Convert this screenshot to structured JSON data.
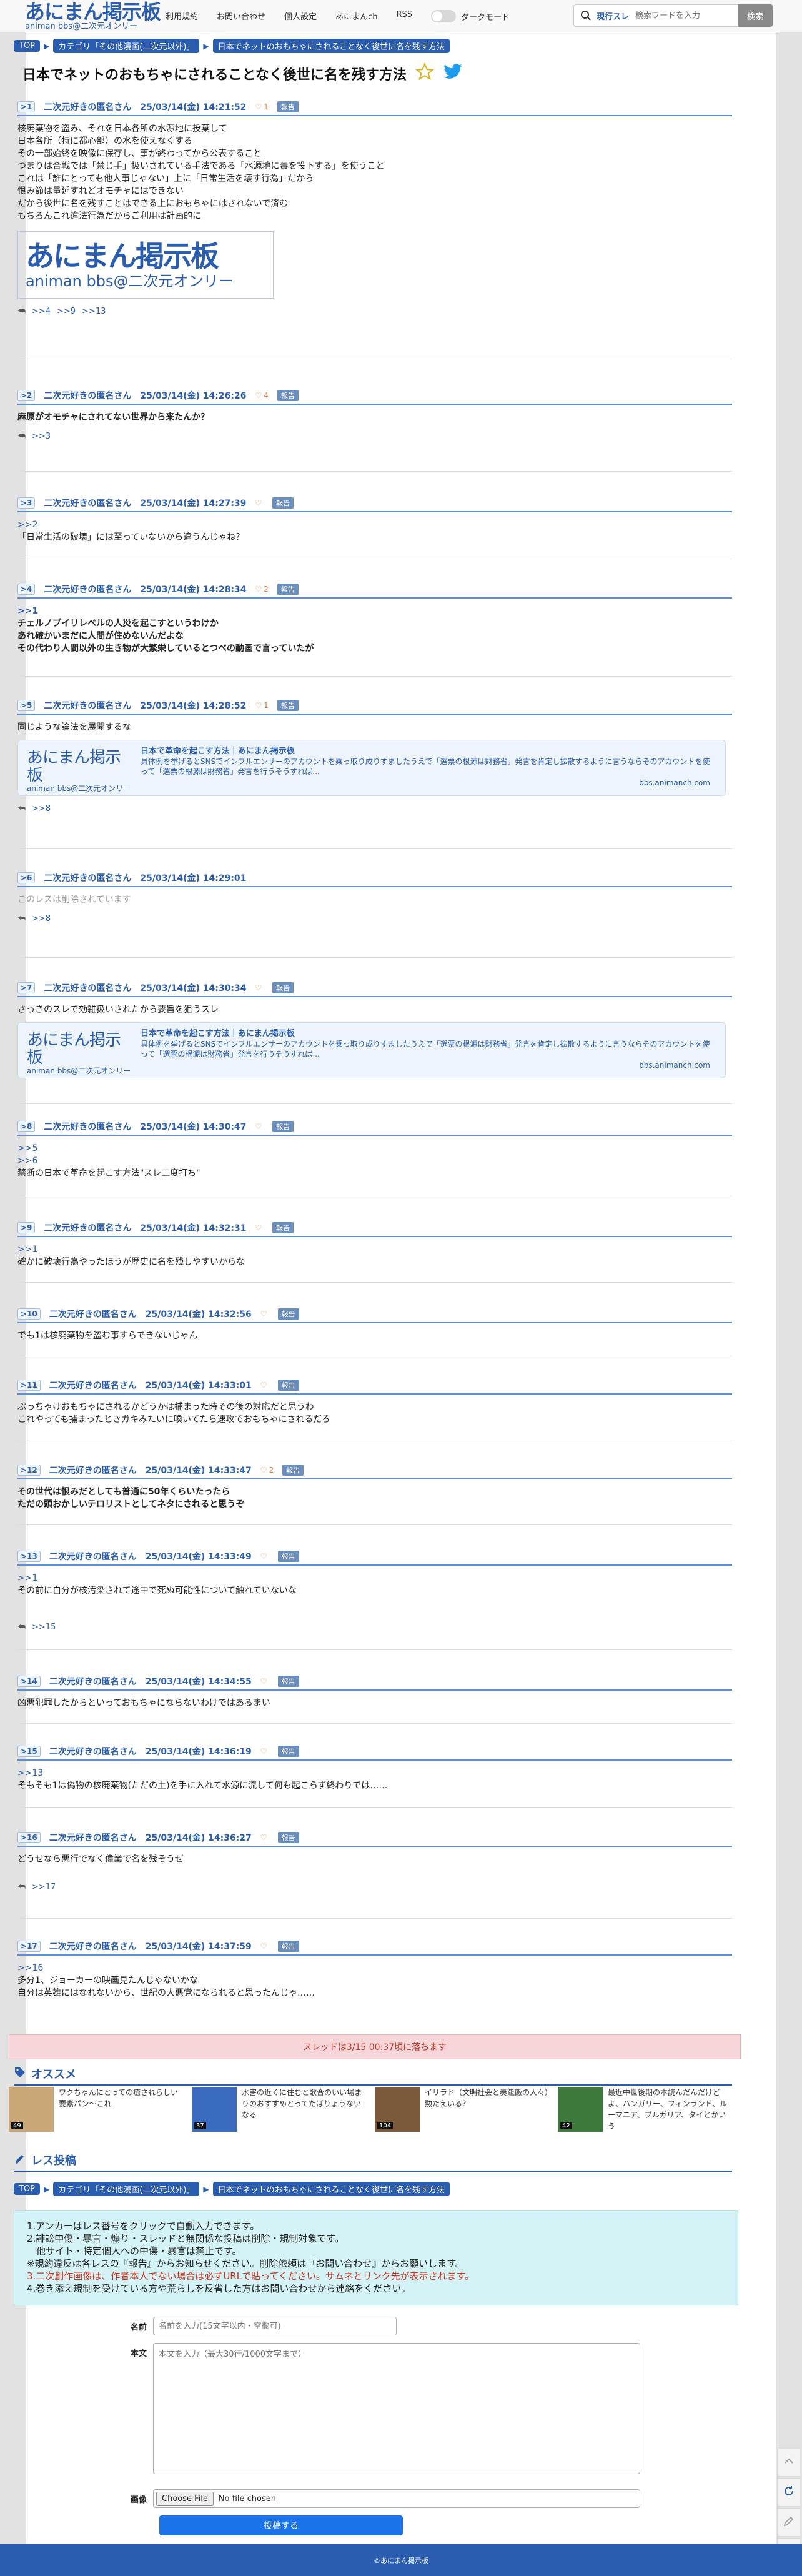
{
  "header": {
    "logo_main": "あにまん掲示板",
    "logo_sub": "animan bbs@二次元オンリー",
    "nav": [
      "利用規約",
      "お問い合わせ",
      "個人設定",
      "あにまんch",
      "RSS"
    ],
    "dark_mode_label": "ダークモード",
    "search_scope": "現行スレ",
    "search_placeholder": "検索ワードを入力",
    "search_button": "検索"
  },
  "breadcrumb": {
    "top": "TOP",
    "category": "カテゴリ「その他漫画(二次元以外)」",
    "thread": "日本でネットのおもちゃにされることなく後世に名を残す方法"
  },
  "thread_title": "日本でネットのおもちゃにされることなく後世に名を残す方法",
  "report_label": "報告",
  "posts": [
    {
      "num": ">1",
      "name": "二次元好きの匿名さん",
      "date": "25/03/14(金) 14:21:52",
      "likes": "1",
      "lines": [
        "核廃棄物を盗み、それを日本各所の水源地に投棄して",
        "日本各所（特に都心部）の水を使えなくする",
        "その一部始終を映像に保存し、事が終わってから公表すること",
        "つまりは合戦では「禁じ手」扱いされている手法である「水源地に毒を投下する」を使うこと",
        "これは「誰にとっても他人事じゃない」上に「日常生活を壊す行為」だから",
        "恨み節は量延すれどオモチャにはできない",
        "だから後世に名を残すことはできる上におもちゃにはされないで済む",
        "もちろんこれ違法行為だからご利用は計画的に"
      ],
      "image_main": "あにまん掲示板",
      "image_sub": "animan bbs@二次元オンリー",
      "replies": [
        ">>4",
        ">>9",
        ">>13"
      ]
    },
    {
      "num": ">2",
      "name": "二次元好きの匿名さん",
      "date": "25/03/14(金) 14:26:26",
      "likes": "4",
      "lines": [
        "麻原がオモチャにされてない世界から来たんか？"
      ],
      "replies": [
        ">>3"
      ]
    },
    {
      "num": ">3",
      "name": "二次元好きの匿名さん",
      "date": "25/03/14(金) 14:27:39",
      "likes": "",
      "anchor": ">>2",
      "lines": [
        "「日常生活の破壊」には至っていないから違うんじゃね？"
      ]
    },
    {
      "num": ">4",
      "name": "二次元好きの匿名さん",
      "date": "25/03/14(金) 14:28:34",
      "likes": "2",
      "anchor": ">>1",
      "lines": [
        "チェルノブイリレベルの人災を起こすというわけか",
        "あれ確かいまだに人間が住めないんだよな",
        "その代わり人間以外の生き物が大繁栄しているとつべの動画で言っていたが"
      ]
    },
    {
      "num": ">5",
      "name": "二次元好きの匿名さん",
      "date": "25/03/14(金) 14:28:52",
      "likes": "1",
      "lines": [
        "同じような論法を展開するな"
      ],
      "link_card": {
        "logo_main": "あにまん掲示板",
        "logo_sub": "animan bbs@二次元オンリー",
        "title": "日本で革命を起こす方法｜あにまん掲示板",
        "desc": "具体例を挙げるとSNSでインフルエンサーのアカウントを乗っ取り成りすましたうえで「選票の根源は財務省」発言を肯定し拡散するように言うならそのアカウントを使って「選票の根源は財務省」発言を行うそうすれば...",
        "domain": "bbs.animanch.com"
      },
      "replies": [
        ">>8"
      ]
    },
    {
      "num": ">6",
      "name": "二次元好きの匿名さん",
      "date": "25/03/14(金) 14:29:01",
      "likes": "",
      "deleted": "このレスは削除されています",
      "replies": [
        ">>8"
      ]
    },
    {
      "num": ">7",
      "name": "二次元好きの匿名さん",
      "date": "25/03/14(金) 14:30:34",
      "likes": "",
      "lines": [
        "さっきのスレで効雑扱いされたから要旨を狙うスレ"
      ],
      "link_card": {
        "logo_main": "あにまん掲示板",
        "logo_sub": "animan bbs@二次元オンリー",
        "title": "日本で革命を起こす方法｜あにまん掲示板",
        "desc": "具体例を挙げるとSNSでインフルエンサーのアカウントを乗っ取り成りすましたうえで「選票の根源は財務省」発言を肯定し拡散するように言うならそのアカウントを使って「選票の根源は財務省」発言を行うそうすれば...",
        "domain": "bbs.animanch.com"
      }
    },
    {
      "num": ">8",
      "name": "二次元好きの匿名さん",
      "date": "25/03/14(金) 14:30:47",
      "likes": "",
      "anchor": ">>5",
      "anchor2": ">>6",
      "lines": [
        "禁断の日本で革命を起こす方法\"スレ二度打ち\""
      ]
    },
    {
      "num": ">9",
      "name": "二次元好きの匿名さん",
      "date": "25/03/14(金) 14:32:31",
      "likes": "",
      "anchor": ">>1",
      "lines": [
        "確かに破壊行為やったほうが歴史に名を残しやすいからな"
      ]
    },
    {
      "num": ">10",
      "name": "二次元好きの匿名さん",
      "date": "25/03/14(金) 14:32:56",
      "likes": "",
      "lines": [
        "でも1は核廃棄物を盗む事すらできないじゃん"
      ]
    },
    {
      "num": ">11",
      "name": "二次元好きの匿名さん",
      "date": "25/03/14(金) 14:33:01",
      "likes": "",
      "lines": [
        "ぶっちゃけおもちゃにされるかどうかは捕まった時その後の対応だと思うわ",
        "これやっても捕まったときガキみたいに喚いてたら速攻でおもちゃにされるだろ"
      ]
    },
    {
      "num": ">12",
      "name": "二次元好きの匿名さん",
      "date": "25/03/14(金) 14:33:47",
      "likes": "2",
      "lines": [
        "その世代は恨みだとしても普通に50年くらいたったら",
        "ただの頭おかしいテロリストとしてネタにされると思うぞ"
      ]
    },
    {
      "num": ">13",
      "name": "二次元好きの匿名さん",
      "date": "25/03/14(金) 14:33:49",
      "likes": "",
      "anchor": ">>1",
      "lines": [
        "その前に自分が核汚染されて途中で死ぬ可能性について触れていないな"
      ],
      "replies": [
        ">>15"
      ]
    },
    {
      "num": ">14",
      "name": "二次元好きの匿名さん",
      "date": "25/03/14(金) 14:34:55",
      "likes": "",
      "lines": [
        "凶悪犯罪したからといっておもちゃにならないわけではあるまい"
      ]
    },
    {
      "num": ">15",
      "name": "二次元好きの匿名さん",
      "date": "25/03/14(金) 14:36:19",
      "likes": "",
      "anchor": ">>13",
      "lines": [
        "そもそも1は偽物の核廃棄物(ただの土)を手に入れて水源に流して何も起こらず終わりでは……"
      ]
    },
    {
      "num": ">16",
      "name": "二次元好きの匿名さん",
      "date": "25/03/14(金) 14:36:27",
      "likes": "",
      "lines": [
        "どうせなら悪行でなく偉業で名を残そうぜ"
      ],
      "replies": [
        ">>17"
      ]
    },
    {
      "num": ">17",
      "name": "二次元好きの匿名さん",
      "date": "25/03/14(金) 14:37:59",
      "likes": "",
      "anchor": ">>16",
      "lines": [
        "多分1、ジョーカーの映画見たんじゃないかな",
        "自分は英雄にはなれないから、世紀の大悪党になられると思ったんじゃ……"
      ]
    }
  ],
  "expire_notice": "スレッドは3/15 00:37頃に落ちます",
  "recommend": {
    "heading": "オススメ",
    "items": [
      {
        "text": "ワクちゃんにとっての癒されらしい要素パン〜これ",
        "count": "49",
        "color": "#c9a777"
      },
      {
        "text": "水害の近くに住むと歌合のいい場まりのおすすめとってたばりょうないなる",
        "count": "37",
        "color": "#3b6bbf"
      },
      {
        "text": "イリラド（文明社会と奏籠飯の人々）勲たえいる？",
        "count": "104",
        "color": "#7a5a3a"
      },
      {
        "text": "最近中世後期の本読んだんだけどよ、ハンガリー、フィンランド、ルーマニア、ブルガリア、タイとかいう",
        "count": "42",
        "color": "#3e7a3e"
      }
    ]
  },
  "post_form": {
    "heading": "レス投稿",
    "rules": [
      "1.アンカーはレス番号をクリックで自動入力できます。",
      "2.誹謗中傷・暴言・煽り・スレッドと無関係な投稿は削除・規制対象です。",
      "　他サイト・特定個人への中傷・暴言は禁止です。",
      "※規約違反は各レスの『報告』からお知らせください。削除依頼は『お問い合わせ』からお願いします。",
      "3.二次創作画像は、作者本人でない場合は必ずURLで貼ってください。サムネとリンク先が表示されます。",
      "4.巻き添え規制を受けている方や荒らしを反省した方はお問い合わせから連絡をください。"
    ],
    "name_label": "名前",
    "name_placeholder": "名前を入力(15文字以内・空欄可)",
    "body_label": "本文",
    "body_placeholder": "本文を入力（最大30行/1000文字まで）",
    "image_label": "画像",
    "file_button": "Choose File",
    "file_status": "No file chosen",
    "submit": "投稿する"
  },
  "footer": "©あにまん掲示板",
  "colors": {
    "accent": "#2a5db0",
    "heart": "#e07a3a",
    "notice_bg": "#f6d6d8"
  }
}
